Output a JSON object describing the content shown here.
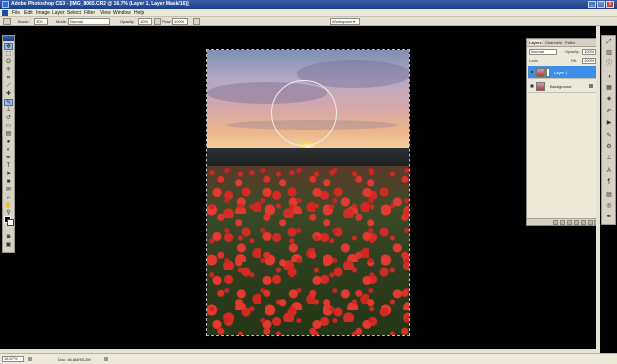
{
  "window": {
    "title": "Adobe Photoshop CS3 - [IMG_8065.CR2 @ 16.7% (Layer 1, Layer Mask/16)]",
    "min_label": "_",
    "max_label": "□",
    "close_label": "x"
  },
  "menu": [
    "File",
    "Edit",
    "Image",
    "Layer",
    "Select",
    "Filter",
    "View",
    "Window",
    "Help"
  ],
  "options": {
    "brush_label": "Brush:",
    "brush_size": "300",
    "mode_label": "Mode:",
    "mode_value": "Normal",
    "opacity_label": "Opacity:",
    "opacity_value": "10%",
    "flow_label": "Flow:",
    "flow_value": "100%",
    "workspace_label": "Workspace ▾"
  },
  "tools": [
    "move",
    "marquee",
    "lasso",
    "quick-select",
    "crop",
    "slice",
    "healing",
    "brush",
    "clone",
    "history-brush",
    "eraser",
    "gradient",
    "blur",
    "dodge",
    "pen",
    "type",
    "path-select",
    "shape",
    "notes",
    "eyedropper",
    "hand",
    "zoom"
  ],
  "layers_panel": {
    "tabs": [
      "Layers",
      "Channels",
      "Paths"
    ],
    "blend_mode": "Normal",
    "opacity_label": "Opacity:",
    "opacity_value": "100%",
    "lock_label": "Lock:",
    "fill_label": "Fill:",
    "fill_value": "100%",
    "layers": [
      {
        "name": "Layer 1",
        "selected": true
      },
      {
        "name": "Background",
        "selected": false
      }
    ]
  },
  "status": {
    "zoom": "16.67%",
    "doc_size": "Doc: 46.6M/93.2M"
  },
  "colors": {
    "accent": "#3c8ee8",
    "foreground": "#000000",
    "background": "#ffffff"
  }
}
